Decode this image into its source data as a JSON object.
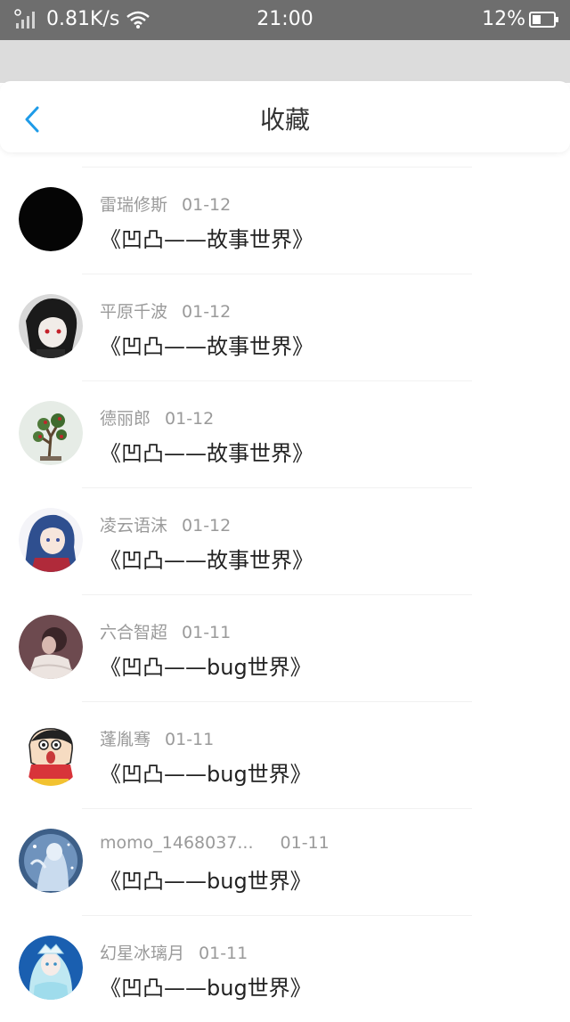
{
  "status_bar": {
    "network_speed": "0.81K/s",
    "time": "21:00",
    "battery": "12%"
  },
  "header": {
    "title": "收藏",
    "back_icon": "chevron-left-icon"
  },
  "favorites": [
    {
      "name": "雷瑞修斯",
      "date": "01-12",
      "title": "《凹凸——故事世界》",
      "avatar": "black"
    },
    {
      "name": "平原千波",
      "date": "01-12",
      "title": "《凹凸——故事世界》",
      "avatar": "anime-dark-hair"
    },
    {
      "name": "德丽郎",
      "date": "01-12",
      "title": "《凹凸——故事世界》",
      "avatar": "bonsai"
    },
    {
      "name": "凌云语沫",
      "date": "01-12",
      "title": "《凹凸——故事世界》",
      "avatar": "anime-blue-hair"
    },
    {
      "name": "六合智超",
      "date": "01-11",
      "title": "《凹凸——bug世界》",
      "avatar": "photo-girl"
    },
    {
      "name": "蓬胤骞",
      "date": "01-11",
      "title": "《凹凸——bug世界》",
      "avatar": "cartoon-boy"
    },
    {
      "name": "momo_1468037...",
      "date": "01-11",
      "title": "《凹凸——bug世界》",
      "avatar": "ice-figure"
    },
    {
      "name": "幻星冰璃月",
      "date": "01-11",
      "title": "《凹凸——bug世界》",
      "avatar": "anime-ice-princess"
    }
  ],
  "colors": {
    "status_bar_bg": "#6e6e6e",
    "accent_back": "#1e9be8",
    "text_primary": "#222222",
    "text_secondary": "#9a9a9a"
  }
}
